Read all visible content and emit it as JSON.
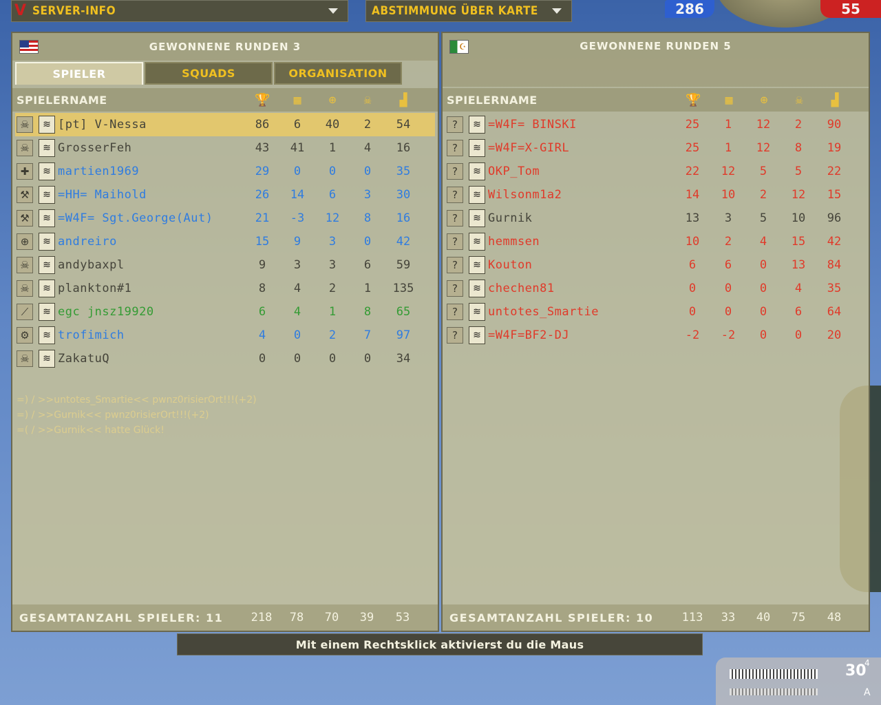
{
  "top": {
    "server_info": "SERVER-INFO",
    "vote_map": "ABSTIMMUNG ÜBER KARTE",
    "tickets_left": "286",
    "tickets_right": "55"
  },
  "left": {
    "team": "US",
    "wins": "GEWONNENE RUNDEN 3",
    "tabs": [
      "SPIELER",
      "SQUADS",
      "ORGANISATION"
    ],
    "col_name": "SPIELERNAME",
    "players": [
      {
        "kit": "skull-icon",
        "name": "[pt] V-Nessa",
        "color": "gray",
        "hl": true,
        "s": [
          "86",
          "6",
          "40",
          "2",
          "54"
        ]
      },
      {
        "kit": "skull-icon",
        "name": "GrosserFeh",
        "color": "gray",
        "s": [
          "43",
          "41",
          "1",
          "4",
          "16"
        ]
      },
      {
        "kit": "medic-icon",
        "name": "martien1969",
        "color": "blue",
        "s": [
          "29",
          "0",
          "0",
          "0",
          "35"
        ]
      },
      {
        "kit": "antitank-icon",
        "name": "=HH= Maihold",
        "color": "blue",
        "s": [
          "26",
          "14",
          "6",
          "3",
          "30"
        ]
      },
      {
        "kit": "antitank-icon",
        "name": "=W4F= Sgt.George(Aut)",
        "color": "blue",
        "s": [
          "21",
          "-3",
          "12",
          "8",
          "16"
        ]
      },
      {
        "kit": "sniper-icon",
        "name": "andreiro",
        "color": "blue",
        "s": [
          "15",
          "9",
          "3",
          "0",
          "42"
        ]
      },
      {
        "kit": "skull-icon",
        "name": "andybaxpl",
        "color": "gray",
        "s": [
          "9",
          "3",
          "3",
          "6",
          "59"
        ]
      },
      {
        "kit": "skull-icon",
        "name": "plankton#1",
        "color": "gray",
        "s": [
          "8",
          "4",
          "2",
          "1",
          "135"
        ]
      },
      {
        "kit": "assault-icon",
        "name": "egc jnsz19920",
        "color": "green",
        "s": [
          "6",
          "4",
          "1",
          "8",
          "65"
        ]
      },
      {
        "kit": "engineer-icon",
        "name": "trofimich",
        "color": "blue",
        "s": [
          "4",
          "0",
          "2",
          "7",
          "97"
        ]
      },
      {
        "kit": "skull-icon",
        "name": "ZakatuQ",
        "color": "gray",
        "s": [
          "0",
          "0",
          "0",
          "0",
          "34"
        ]
      }
    ],
    "chat": [
      "=) / >>untotes_Smartie<< pwnz0risierOrt!!!(+2)",
      "=) / >>Gurnik<< pwnz0risierOrt!!!(+2)",
      "=( / >>Gurnik<< hatte Glück!"
    ],
    "total_label": "GESAMTANZAHL SPIELER: 11",
    "totals": [
      "218",
      "78",
      "70",
      "39",
      "53"
    ]
  },
  "right": {
    "team": "MEC",
    "wins": "GEWONNENE RUNDEN 5",
    "col_name": "SPIELERNAME",
    "players": [
      {
        "name": "=W4F= BINSKI",
        "color": "red",
        "s": [
          "25",
          "1",
          "12",
          "2",
          "90"
        ]
      },
      {
        "name": "=W4F=X-GIRL",
        "color": "red",
        "s": [
          "25",
          "1",
          "12",
          "8",
          "19"
        ]
      },
      {
        "name": "OKP_Tom",
        "color": "red",
        "s": [
          "22",
          "12",
          "5",
          "5",
          "22"
        ]
      },
      {
        "name": "Wilsonm1a2",
        "color": "red",
        "s": [
          "14",
          "10",
          "2",
          "12",
          "15"
        ]
      },
      {
        "name": "Gurnik",
        "color": "gray",
        "s": [
          "13",
          "3",
          "5",
          "10",
          "96"
        ]
      },
      {
        "name": "hemmsen",
        "color": "red",
        "s": [
          "10",
          "2",
          "4",
          "15",
          "42"
        ]
      },
      {
        "name": "Kouton",
        "color": "red",
        "s": [
          "6",
          "6",
          "0",
          "13",
          "84"
        ]
      },
      {
        "name": "chechen81",
        "color": "red",
        "s": [
          "0",
          "0",
          "0",
          "4",
          "35"
        ]
      },
      {
        "name": "untotes_Smartie",
        "color": "red",
        "s": [
          "0",
          "0",
          "0",
          "6",
          "64"
        ]
      },
      {
        "name": "=W4F=BF2-DJ",
        "color": "red",
        "s": [
          "-2",
          "-2",
          "0",
          "0",
          "20"
        ]
      }
    ],
    "total_label": "GESAMTANZAHL SPIELER: 10",
    "totals": [
      "113",
      "33",
      "40",
      "75",
      "48"
    ]
  },
  "hint": "Mit einem Rechtsklick aktivierst du die Maus",
  "hud": {
    "mag": "30",
    "mag_sup": "4",
    "fire_mode": "A"
  }
}
